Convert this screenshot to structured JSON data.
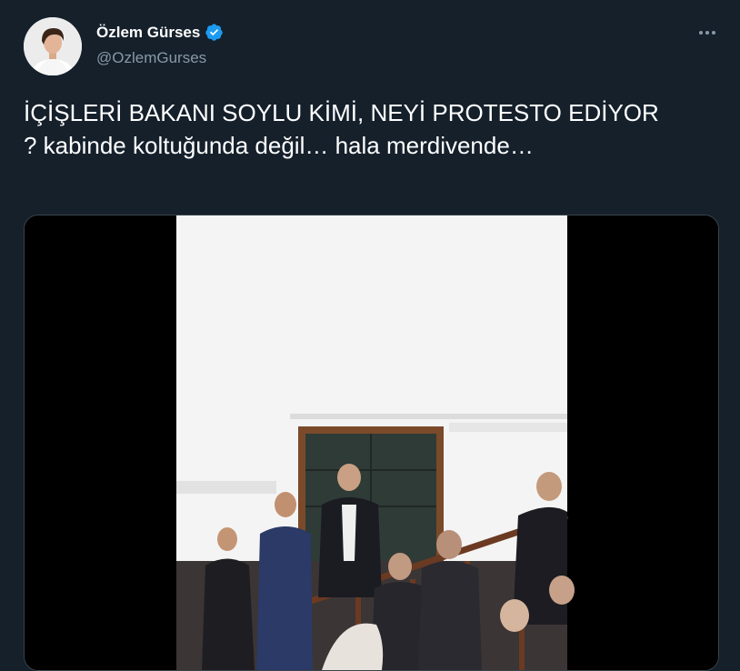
{
  "author": {
    "display_name": "Özlem Gürses",
    "handle": "@OzlemGurses",
    "verified": true,
    "avatar_icon": "profile-photo"
  },
  "tweet": {
    "text": "İÇİŞLERİ BAKANI SOYLU KİMİ, NEYİ PROTESTO EDİYOR ? kabinde koltuğunda değil… hala merdivende…"
  },
  "media": {
    "type": "video",
    "description_icon": "video-frame-parliament"
  },
  "colors": {
    "background": "#15202b",
    "text": "#ffffff",
    "secondary_text": "#8899a6",
    "verified_badge": "#1d9bf0",
    "border": "#38444d"
  },
  "icons": {
    "more": "more-horizontal-icon",
    "verified": "verified-badge-icon"
  }
}
